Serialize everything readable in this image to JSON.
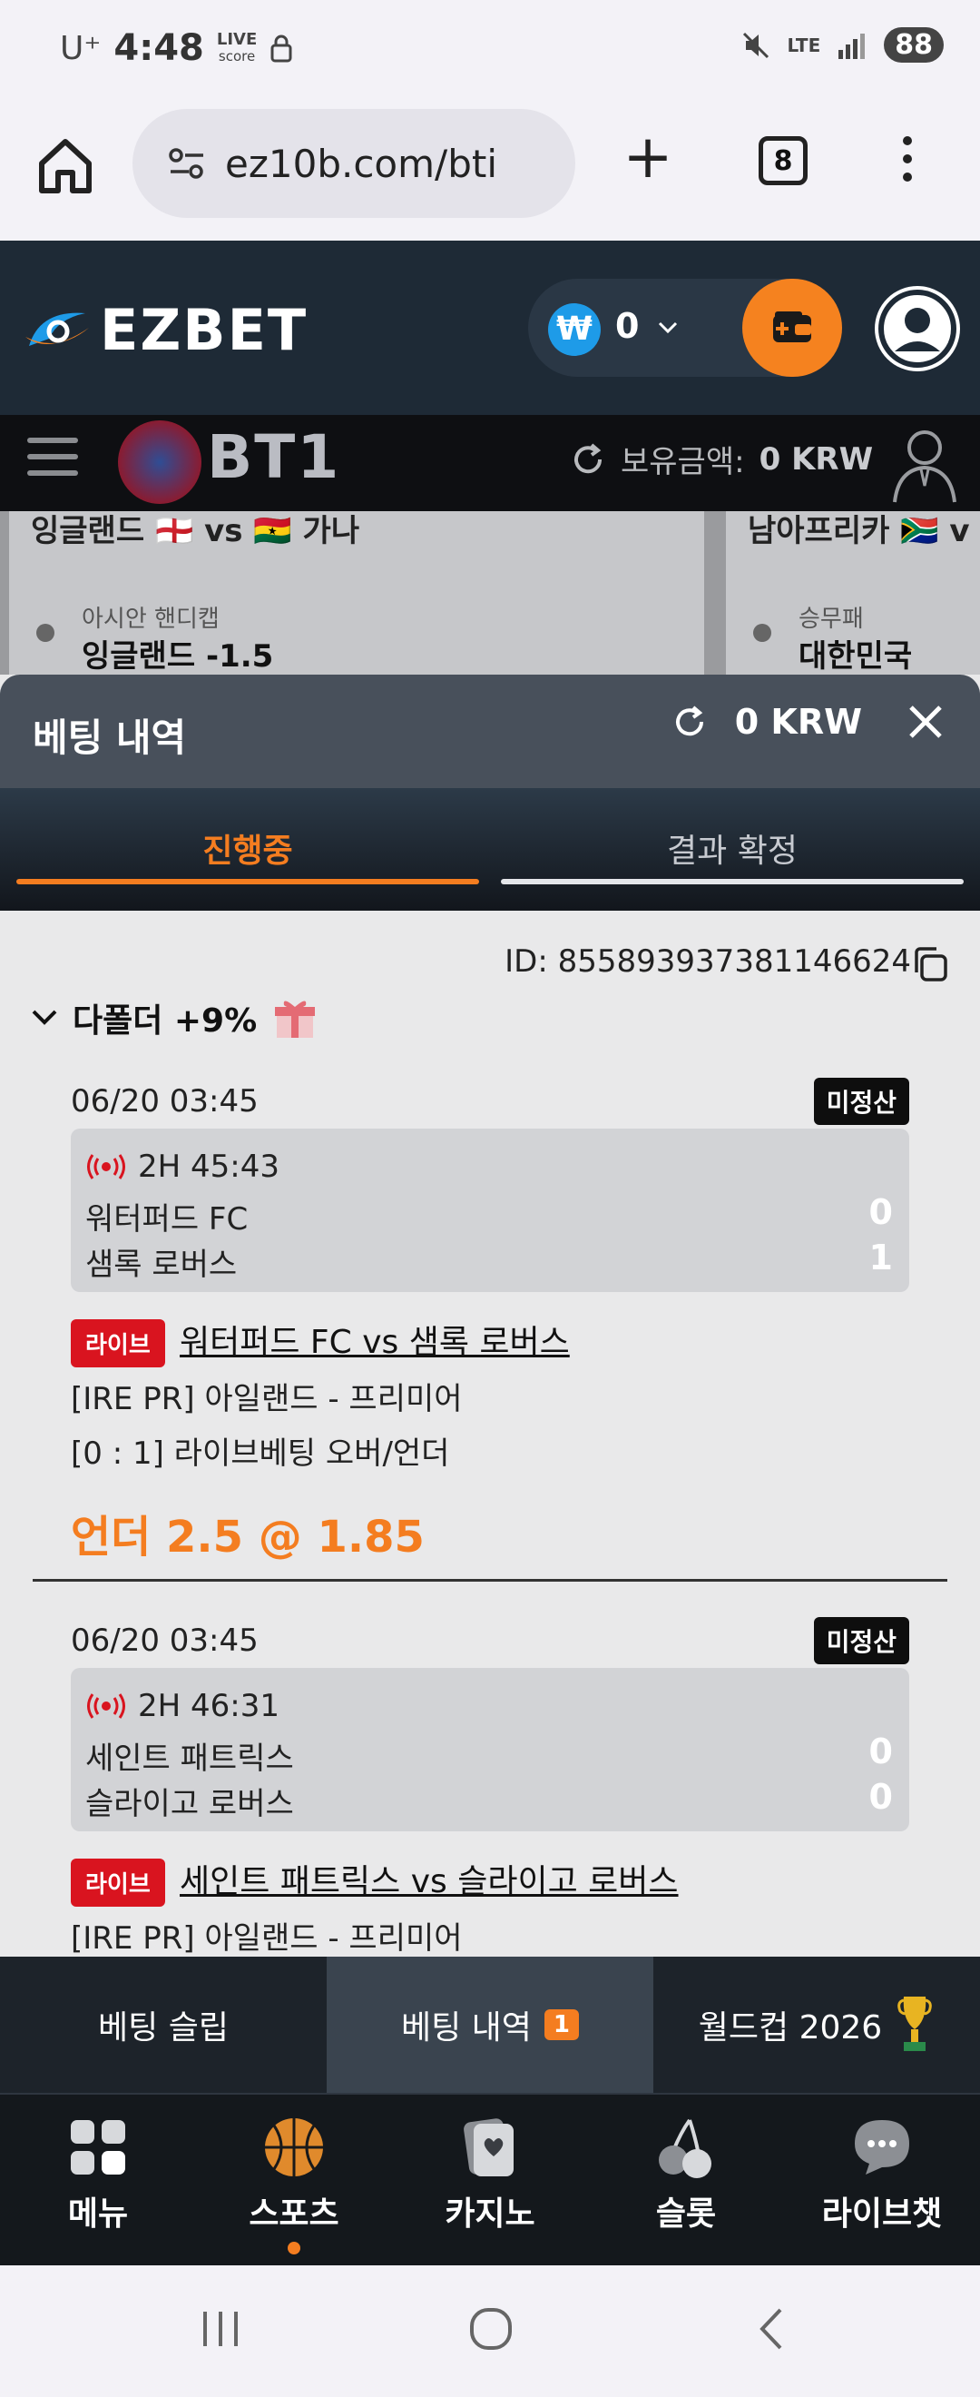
{
  "status_bar": {
    "carrier": "U⁺",
    "time": "4:48",
    "live_score_l1": "LIVE",
    "live_score_l2": "score",
    "network": "LTE",
    "battery": "88"
  },
  "browser": {
    "url": "ez10b.com/bti",
    "tab_count": "8"
  },
  "site_header": {
    "brand": "EZBET",
    "wallet_symbol": "₩",
    "wallet_amount": "0"
  },
  "bt1_bar": {
    "logo_text": "BT1",
    "balance_label": "보유금액:",
    "balance_value": "0 KRW"
  },
  "background_cards": [
    {
      "match": "잉글랜드 🏴󠁧󠁢󠁥󠁮󠁧󠁿 vs 🇬🇭 가나",
      "market": "아시안 핸디캡",
      "pick": "잉글랜드 -1.5"
    },
    {
      "match": "남아프리카 🇿🇦 v",
      "market": "승무패",
      "pick": "대한민국"
    }
  ],
  "panel": {
    "title": "베팅 내역",
    "balance": "0 KRW",
    "tabs": [
      "진행중",
      "결과 확정"
    ]
  },
  "bet": {
    "id": "ID: 855893937381146624",
    "type": "다폴더 +9%",
    "legs": [
      {
        "date": "06/20 03:45",
        "status": "미정산",
        "clock": "2H 45:43",
        "home": "워터퍼드 FC",
        "away": "샘록 로버스",
        "home_score": "0",
        "away_score": "1",
        "live_label": "라이브",
        "match": "워터퍼드 FC vs 샘록 로버스",
        "league": "[IRE PR] 아일랜드 - 프리미어",
        "market": "[0 : 1] 라이브베팅 오버/언더",
        "pick": "언더 2.5 @ 1.85"
      },
      {
        "date": "06/20 03:45",
        "status": "미정산",
        "clock": "2H 46:31",
        "home": "세인트 패트릭스",
        "away": "슬라이고 로버스",
        "home_score": "0",
        "away_score": "0",
        "live_label": "라이브",
        "match": "세인트 패트릭스 vs 슬라이고 로버스",
        "league": "[IRE PR] 아일랜드 - 프리미어"
      }
    ]
  },
  "sub_tabs": [
    {
      "label": "베팅 슬립"
    },
    {
      "label": "베팅 내역",
      "count": "1"
    },
    {
      "label": "월드컵 2026"
    }
  ],
  "bottom_nav": [
    {
      "label": "메뉴",
      "icon": "grid-icon"
    },
    {
      "label": "스포츠",
      "icon": "basketball-icon"
    },
    {
      "label": "카지노",
      "icon": "cards-icon"
    },
    {
      "label": "슬롯",
      "icon": "cherry-icon"
    },
    {
      "label": "라이브챗",
      "icon": "chat-icon"
    }
  ],
  "colors": {
    "accent": "#f47d20",
    "header_bg": "#1e2a36",
    "live_red": "#d9141f"
  }
}
